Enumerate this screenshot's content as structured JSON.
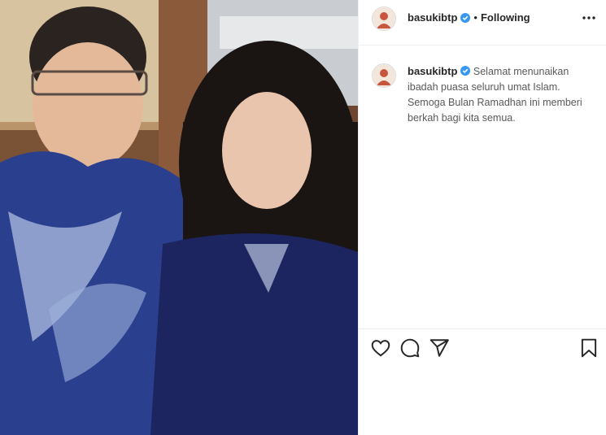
{
  "post": {
    "username": "basukibtp",
    "separator": "•",
    "follow_label": "Following",
    "caption": "Selamat menunaikan ibadah puasa seluruh umat Islam. Semoga Bulan Ramadhan ini memberi berkah bagi kita semua."
  },
  "icons": {
    "more": "more-options-icon",
    "like": "heart-icon",
    "comment": "comment-icon",
    "share": "paper-plane-icon",
    "save": "bookmark-icon",
    "verified": "verified-badge-icon"
  },
  "colors": {
    "verified_blue": "#3897f0",
    "text": "#262626",
    "border": "#efefef"
  }
}
